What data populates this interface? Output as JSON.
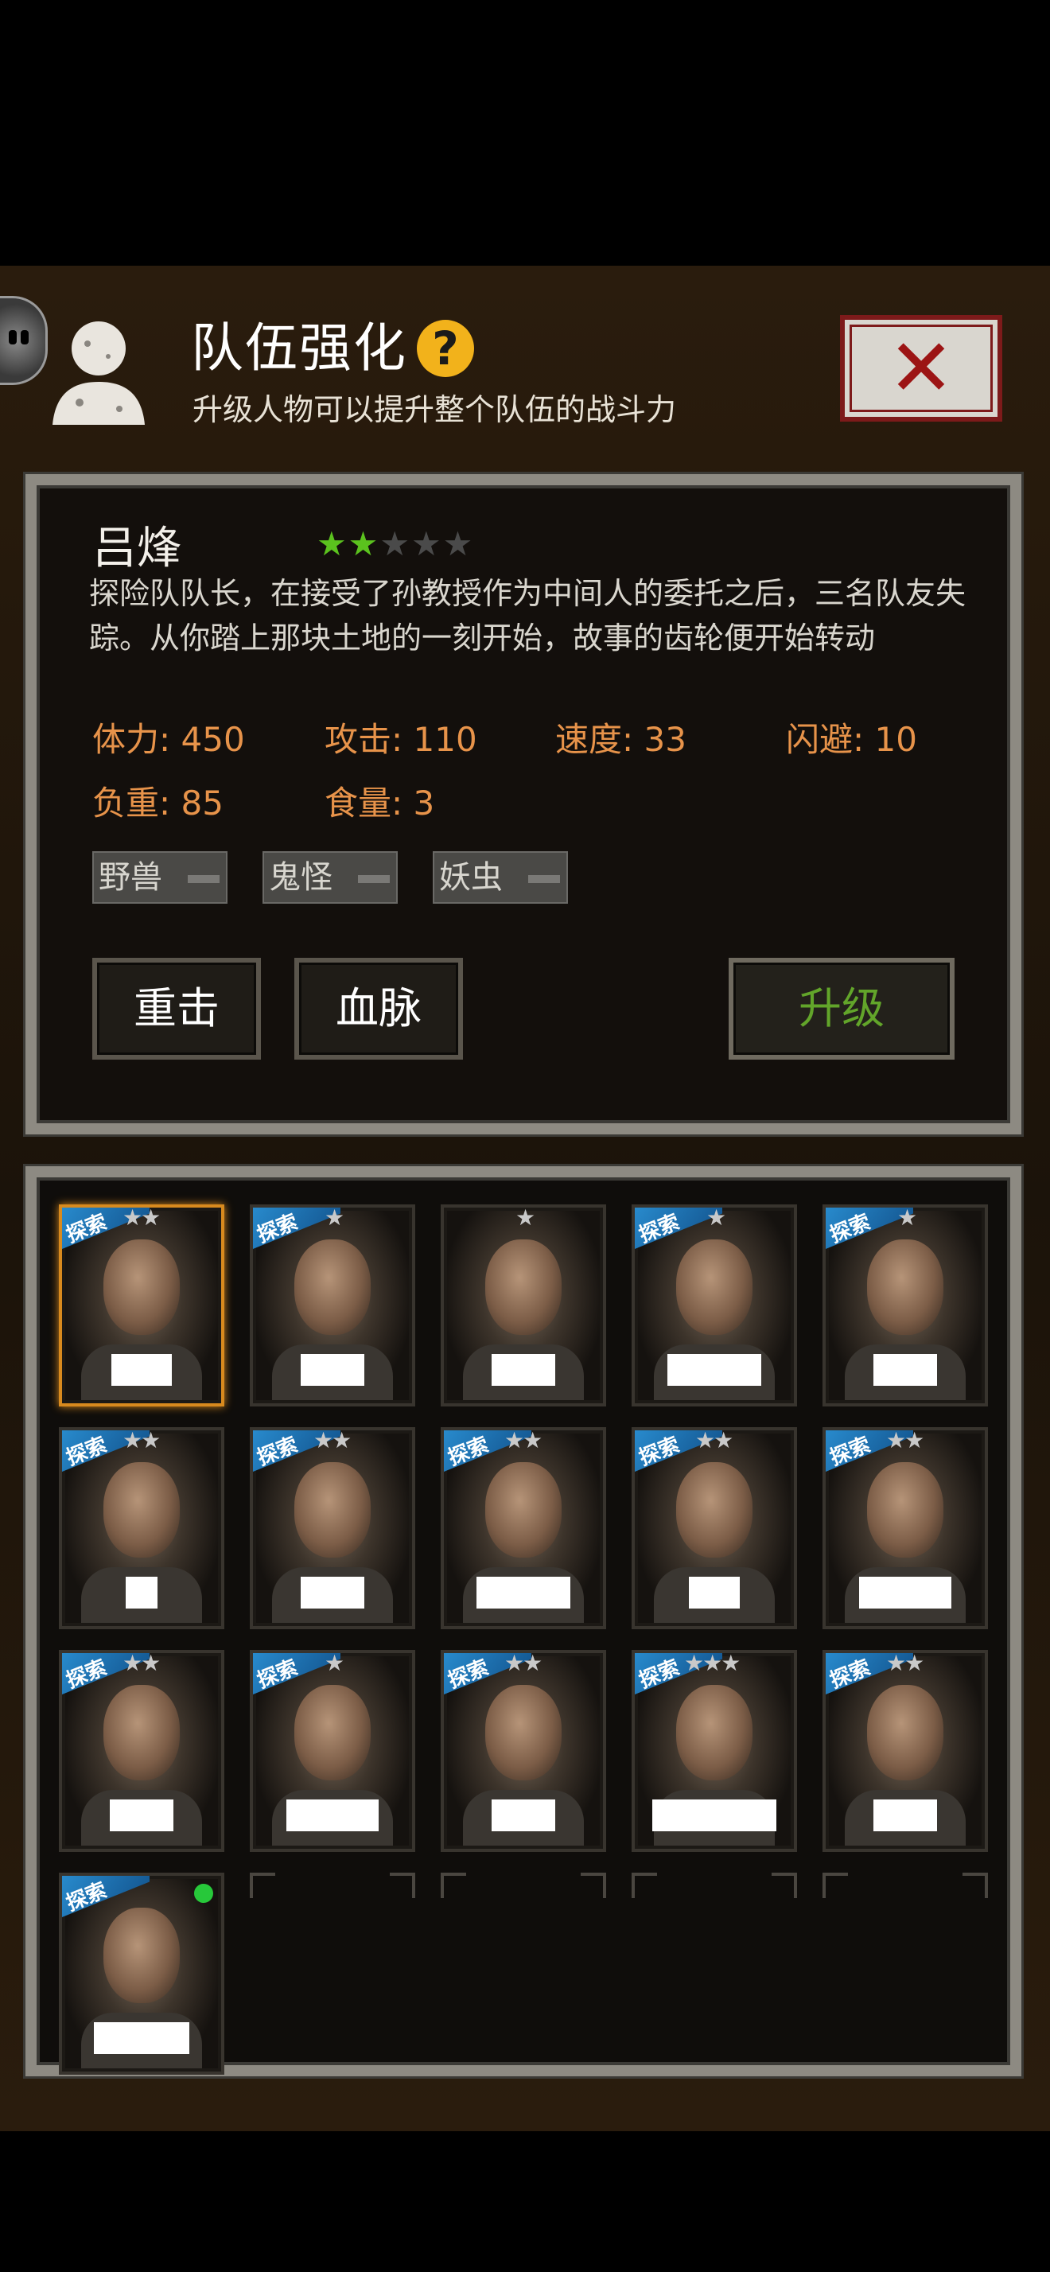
{
  "header": {
    "title": "队伍强化",
    "subtitle": "升级人物可以提升整个队伍的战斗力",
    "help_symbol": "?",
    "close_symbol": "✕"
  },
  "character": {
    "name": "吕烽",
    "star_rating": 2,
    "max_stars": 5,
    "description": "探险队队长，在接受了孙教授作为中间人的委托之后，三名队友失踪。从你踏上那块土地的一刻开始，故事的齿轮便开始转动",
    "stats": [
      {
        "label": "体力: 450"
      },
      {
        "label": "攻击: 110"
      },
      {
        "label": "速度: 33"
      },
      {
        "label": "闪避: 10"
      },
      {
        "label": "负重: 85"
      },
      {
        "label": "食量: 3"
      }
    ],
    "tags": [
      "野兽",
      "鬼怪",
      "妖虫"
    ]
  },
  "actions": {
    "skill1": "重击",
    "skill2": "血脉",
    "upgrade": "升级"
  },
  "roster": {
    "ribbon_label": "探索",
    "cards": [
      {
        "stars": 2,
        "selected": true
      },
      {
        "stars": 1
      },
      {
        "stars": 1
      },
      {
        "stars": 1
      },
      {
        "stars": 1
      },
      {
        "stars": 2
      },
      {
        "stars": 2
      },
      {
        "stars": 2
      },
      {
        "stars": 2
      },
      {
        "stars": 2
      },
      {
        "stars": 2
      },
      {
        "stars": 1
      },
      {
        "stars": 2
      },
      {
        "stars": 3
      },
      {
        "stars": 2
      },
      {
        "stars": 0,
        "online": true
      }
    ],
    "empty_slots": 4
  },
  "colors": {
    "star_active": "#5bc21e",
    "star_inactive": "#4a4a4a",
    "stat_text": "#e7934a",
    "upgrade_text": "#62a52a",
    "selected_border": "#d88a1e"
  }
}
